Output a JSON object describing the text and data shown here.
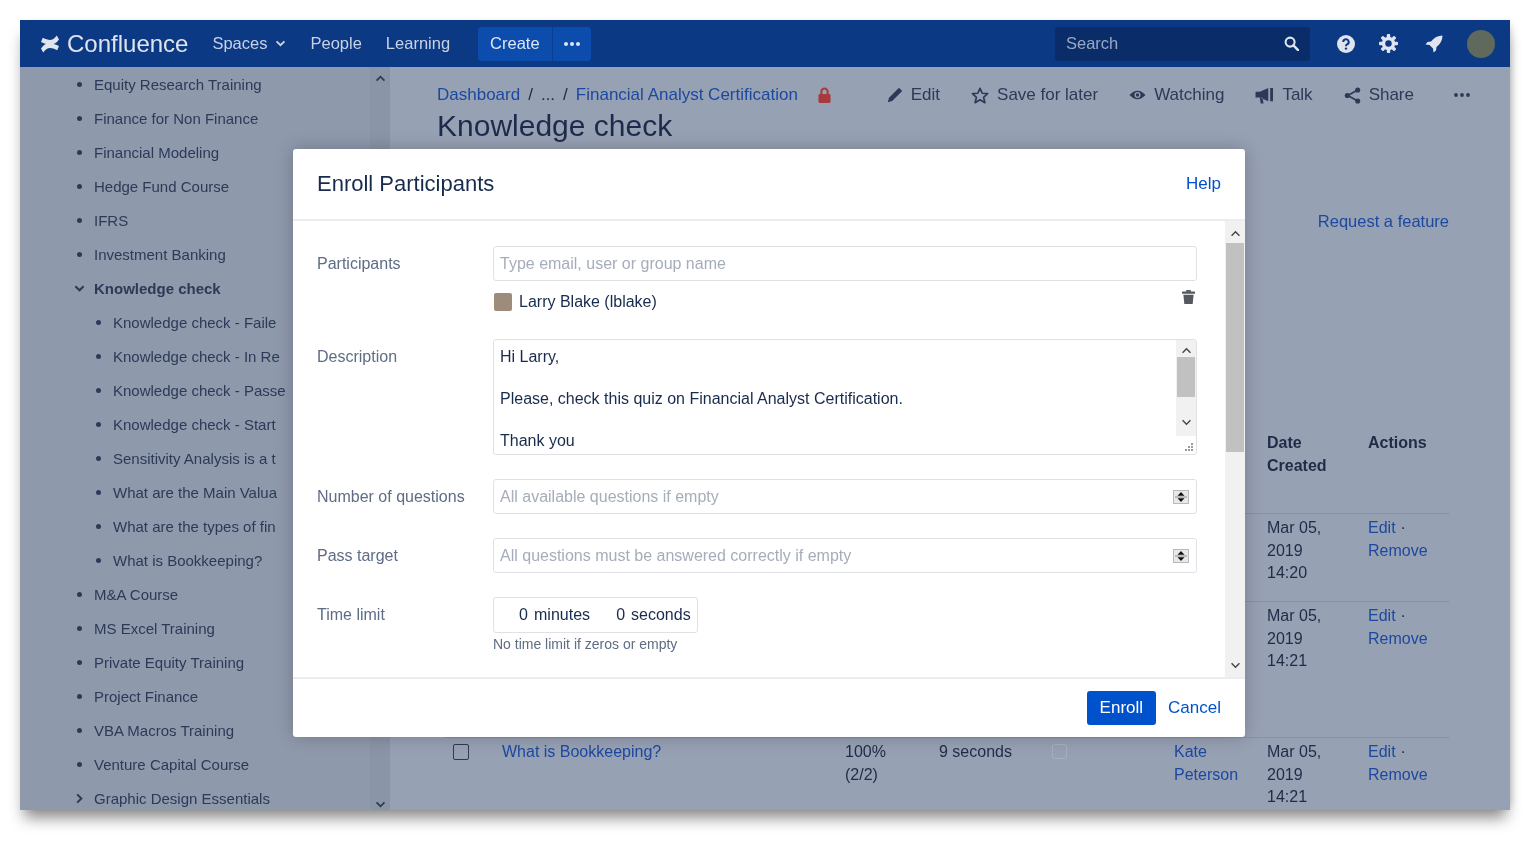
{
  "nav": {
    "logo": "Confluence",
    "items": [
      {
        "label": "Spaces",
        "dropdown": true
      },
      {
        "label": "People",
        "dropdown": false
      },
      {
        "label": "Learning",
        "dropdown": false
      }
    ],
    "create": "Create",
    "search": {
      "placeholder": "Search"
    }
  },
  "sidebar": {
    "items": [
      {
        "kind": "page",
        "label": "Equity Research Training",
        "selected": false
      },
      {
        "kind": "page",
        "label": "Finance for Non Finance",
        "selected": false
      },
      {
        "kind": "page",
        "label": "Financial Modeling",
        "selected": false
      },
      {
        "kind": "page",
        "label": "Hedge Fund Course",
        "selected": false
      },
      {
        "kind": "page",
        "label": "IFRS",
        "selected": false
      },
      {
        "kind": "page",
        "label": "Investment Banking",
        "selected": false
      },
      {
        "kind": "parent",
        "label": "Knowledge check",
        "selected": true,
        "expanded": true,
        "children": [
          {
            "kind": "page",
            "label": "Knowledge check - Faile",
            "selected": false
          },
          {
            "kind": "page",
            "label": "Knowledge check - In Re",
            "selected": false
          },
          {
            "kind": "page",
            "label": "Knowledge check - Passe",
            "selected": false
          },
          {
            "kind": "page",
            "label": "Knowledge check - Start",
            "selected": false
          },
          {
            "kind": "page",
            "label": "Sensitivity Analysis is a t",
            "selected": false
          },
          {
            "kind": "page",
            "label": "What are the Main Valua",
            "selected": false
          },
          {
            "kind": "page",
            "label": "What are the types of fin",
            "selected": false
          },
          {
            "kind": "page",
            "label": "What is Bookkeeping?",
            "selected": false
          }
        ]
      },
      {
        "kind": "page",
        "label": "M&A Course",
        "selected": false
      },
      {
        "kind": "page",
        "label": "MS Excel Training",
        "selected": false
      },
      {
        "kind": "page",
        "label": "Private Equity Training",
        "selected": false
      },
      {
        "kind": "page",
        "label": "Project Finance",
        "selected": false
      },
      {
        "kind": "page",
        "label": "VBA Macros Training",
        "selected": false
      },
      {
        "kind": "page",
        "label": "Venture Capital Course",
        "selected": false
      },
      {
        "kind": "parent",
        "label": "Graphic Design Essentials",
        "selected": false,
        "expanded": false
      }
    ]
  },
  "main": {
    "breadcrumbs": [
      {
        "kind": "link",
        "label": "Dashboard"
      },
      {
        "kind": "separator",
        "label": "/"
      },
      {
        "kind": "ellipsis",
        "label": "..."
      },
      {
        "kind": "separator",
        "label": "/"
      },
      {
        "kind": "link",
        "label": "Financial Analyst Certification"
      }
    ],
    "restricted": true,
    "actions": [
      {
        "kind": "edit",
        "label": "Edit"
      },
      {
        "kind": "save",
        "label": "Save for later"
      },
      {
        "kind": "watch",
        "label": "Watching"
      },
      {
        "kind": "talk",
        "label": "Talk"
      },
      {
        "kind": "share",
        "label": "Share"
      }
    ],
    "title": "Knowledge check",
    "request_feature": "Request a feature",
    "table": {
      "columns": [
        {
          "label": "Date Created"
        },
        {
          "label": "Actions"
        }
      ],
      "rows": [
        {
          "date": "Mar 05, 2019 14:20",
          "edit": "Edit",
          "separator": "·",
          "remove": "Remove"
        },
        {
          "date": "Mar 05, 2019 14:21",
          "edit": "Edit",
          "separator": "·",
          "remove": "Remove"
        },
        {
          "checked": false,
          "title": "What is Bookkeeping?",
          "score": "100% (2/2)",
          "time": "9 seconds",
          "column_5": {
            "checked": false,
            "disabled": true
          },
          "user": "Kate Peterson",
          "date": "Mar 05, 2019 14:21",
          "edit": "Edit",
          "separator": "·",
          "remove": "Remove"
        }
      ]
    }
  },
  "dialog": {
    "title": "Enroll Participants",
    "help": "Help",
    "fields": [
      {
        "kind": "people",
        "label": "Participants",
        "placeholder": "Type email, user or group name",
        "entries": [
          {
            "name": "Larry Blake (lblake)"
          }
        ]
      },
      {
        "kind": "textarea",
        "label": "Description",
        "paragraphs": [
          "Hi Larry,",
          "Please, check this quiz on Financial Analyst Certification.",
          "Thank you"
        ]
      },
      {
        "kind": "number",
        "label": "Number of questions",
        "placeholder": "All available questions if empty"
      },
      {
        "kind": "number",
        "label": "Pass target",
        "placeholder": "All questions must be answered correctly if empty"
      },
      {
        "kind": "duration",
        "label": "Time limit",
        "minutes": "0",
        "minutes_unit": "minutes",
        "seconds": "0",
        "seconds_unit": "seconds",
        "hint": "No time limit if zeros or empty"
      }
    ],
    "buttons": [
      {
        "kind": "primary",
        "label": "Enroll"
      },
      {
        "kind": "link",
        "label": "Cancel"
      }
    ]
  }
}
